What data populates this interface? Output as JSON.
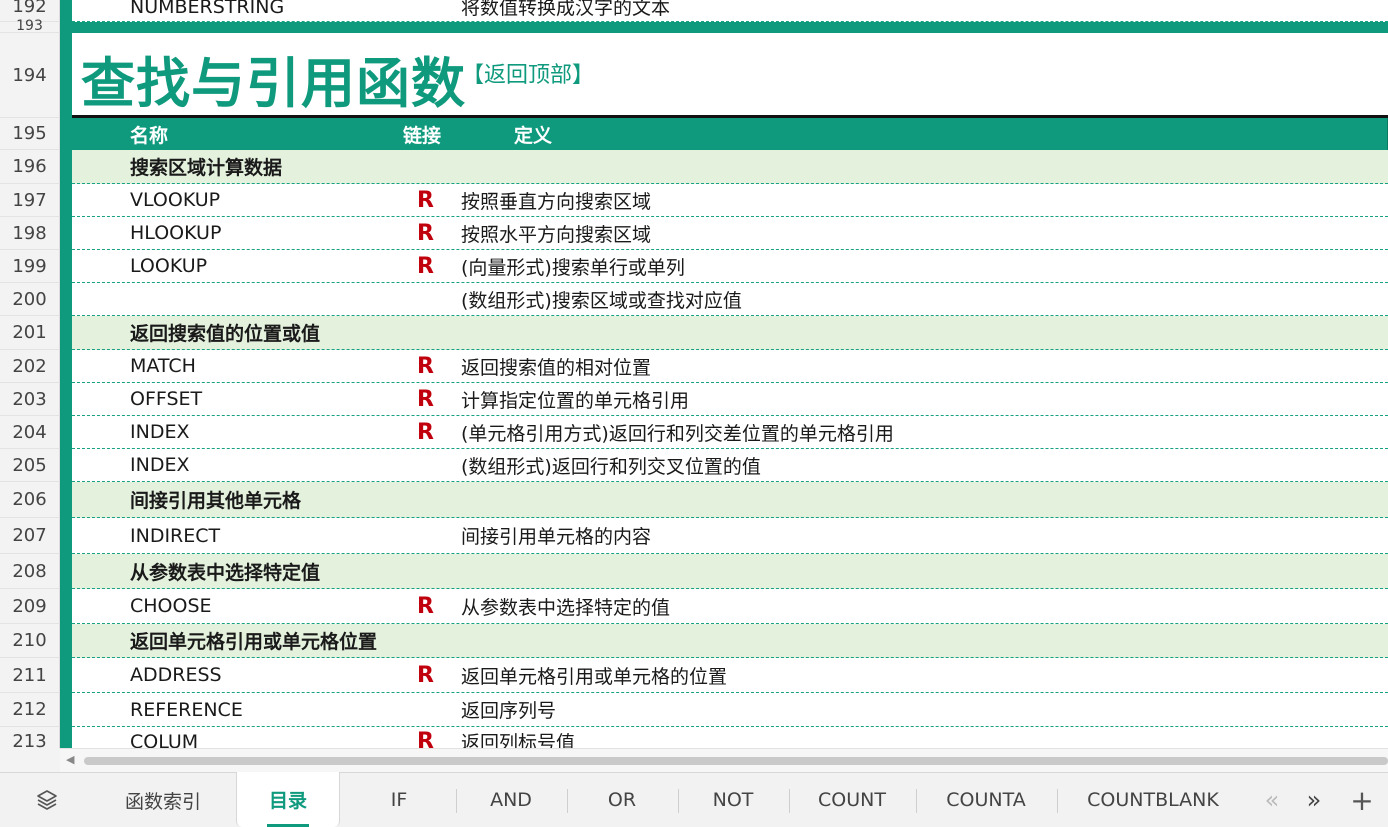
{
  "sheet": {
    "top_rows": [
      {
        "num": "192",
        "name": "NUMBERSTRING",
        "def": "将数值转换成汉字的文本"
      },
      {
        "num": "193"
      }
    ],
    "title_row": {
      "num": "194",
      "title": "查找与引用函数",
      "back_link": "【返回顶部】"
    },
    "header_row": {
      "num": "195",
      "col_name": "名称",
      "col_link": "链接",
      "col_def": "定义"
    },
    "rows": [
      {
        "num": "196",
        "type": "cat",
        "name": "搜索区域计算数据"
      },
      {
        "num": "197",
        "type": "data",
        "name": "VLOOKUP",
        "link": "R",
        "def": "按照垂直方向搜索区域"
      },
      {
        "num": "198",
        "type": "data",
        "name": "HLOOKUP",
        "link": "R",
        "def": "按照水平方向搜索区域"
      },
      {
        "num": "199",
        "type": "data",
        "name": "LOOKUP",
        "link": "R",
        "def": "(向量形式)搜索单行或单列"
      },
      {
        "num": "200",
        "type": "data",
        "name": "",
        "link": "",
        "def": "(数组形式)搜索区域或查找对应值"
      },
      {
        "num": "201",
        "type": "cat",
        "name": "返回搜索值的位置或值"
      },
      {
        "num": "202",
        "type": "data",
        "name": "MATCH",
        "link": "R",
        "def": "返回搜索值的相对位置"
      },
      {
        "num": "203",
        "type": "data",
        "name": "OFFSET",
        "link": "R",
        "def": "计算指定位置的单元格引用"
      },
      {
        "num": "204",
        "type": "data",
        "name": "INDEX",
        "link": "R",
        "def": "(单元格引用方式)返回行和列交差位置的单元格引用"
      },
      {
        "num": "205",
        "type": "data",
        "name": "INDEX",
        "link": "",
        "def": "(数组形式)返回行和列交叉位置的值"
      },
      {
        "num": "206",
        "type": "cat",
        "name": "间接引用其他单元格"
      },
      {
        "num": "207",
        "type": "data",
        "name": "INDIRECT",
        "link": "",
        "def": "间接引用单元格的内容"
      },
      {
        "num": "208",
        "type": "cat",
        "name": "从参数表中选择特定值"
      },
      {
        "num": "209",
        "type": "data",
        "name": "CHOOSE",
        "link": "R",
        "def": "从参数表中选择特定的值"
      },
      {
        "num": "210",
        "type": "cat",
        "name": "返回单元格引用或单元格位置"
      },
      {
        "num": "211",
        "type": "data",
        "name": "ADDRESS",
        "link": "R",
        "def": "返回单元格引用或单元格的位置"
      },
      {
        "num": "212",
        "type": "data",
        "name": "REFERENCE",
        "link": "",
        "def": "返回序列号"
      },
      {
        "num": "213",
        "type": "data",
        "name": "COLUM",
        "link": "R",
        "def": "返回列标号值"
      }
    ]
  },
  "tabs": {
    "items": [
      "函数索引",
      "目录",
      "IF",
      "AND",
      "OR",
      "NOT",
      "COUNT",
      "COUNTA",
      "COUNTBLANK"
    ],
    "active": "目录",
    "icons": {
      "sheets": "layers-icon",
      "prev": "double-chevron-left-icon",
      "next": "double-chevron-right-icon",
      "add": "plus-icon"
    }
  },
  "colors": {
    "accent": "#0f9a7e",
    "category_bg": "#e3f1dd",
    "link_red": "#c0000c"
  }
}
